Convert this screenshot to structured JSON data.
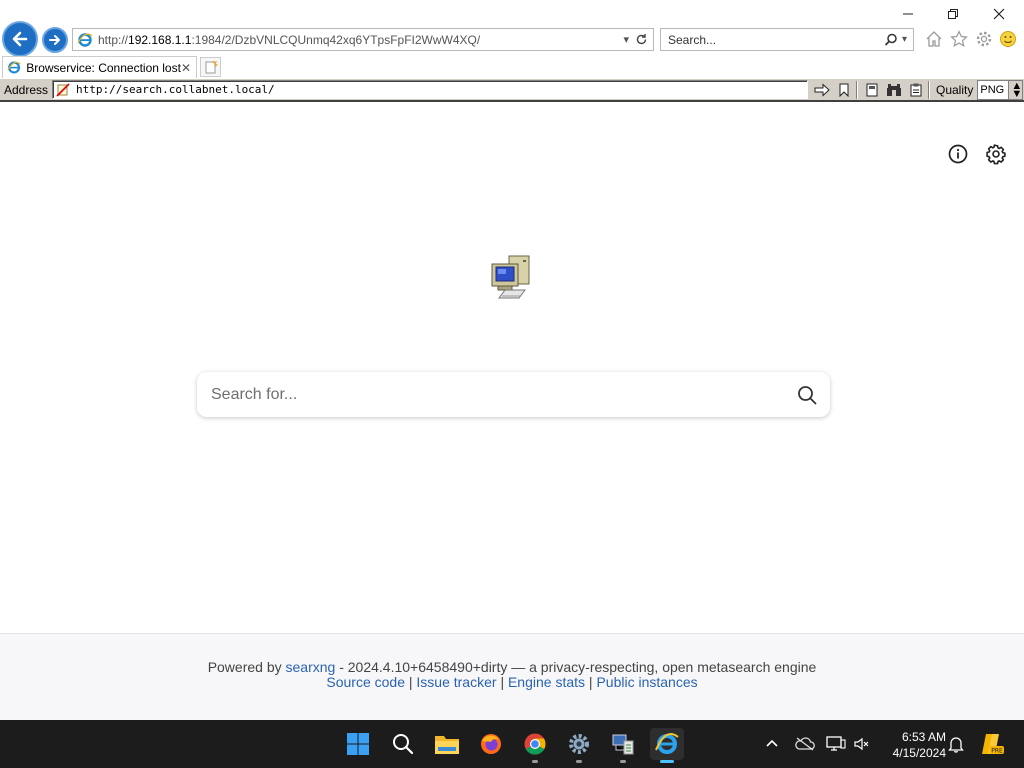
{
  "browser": {
    "url_prefix": "http://",
    "url_host": "192.168.1.1",
    "url_rest": ":1984/2/DzbVNLCQUnmq42xq6YTpsFpFI2WwW4XQ/",
    "search_placeholder": "Search...",
    "tab_title": "Browservice: Connection lost"
  },
  "browservice": {
    "address_label": "Address",
    "address_value": "http://search.collabnet.local/",
    "quality_label": "Quality",
    "quality_value": "PNG"
  },
  "page": {
    "search_placeholder": "Search for...",
    "footer": {
      "powered_by": "Powered by",
      "engine_link": "searxng",
      "version_text": " - 2024.4.10+6458490+dirty — a privacy-respecting, open metasearch engine",
      "links": [
        "Source code",
        "Issue tracker",
        "Engine stats",
        "Public instances"
      ],
      "separator": "|"
    }
  },
  "taskbar": {
    "time": "6:53 AM",
    "date": "4/15/2024",
    "apps": [
      "windows-start",
      "search",
      "file-explorer",
      "firefox",
      "chrome",
      "settings",
      "task-manager",
      "internet-explorer"
    ],
    "active_app": "internet-explorer"
  },
  "colors": {
    "ie_blue": "#1e6fc4",
    "link": "#2a63b0",
    "taskbar": "#1c1c1c",
    "classic_gray": "#d4d0c8"
  }
}
